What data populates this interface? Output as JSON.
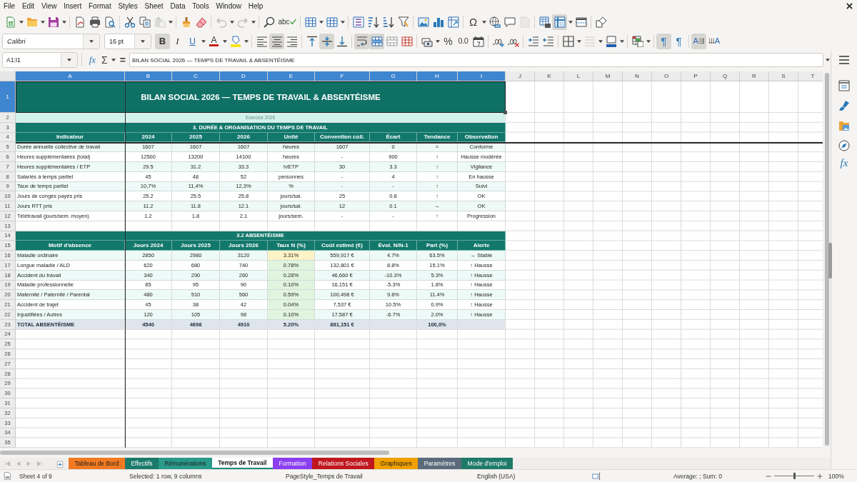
{
  "menu_bar": {
    "items": [
      "File",
      "Edit",
      "View",
      "Insert",
      "Format",
      "Styles",
      "Sheet",
      "Data",
      "Tools",
      "Window",
      "Help"
    ]
  },
  "standard_toolbar": {
    "paste_disabled": true,
    "undo_disabled": true,
    "redo_disabled": true,
    "spelling_label": "abc",
    "special_character_label": "Ω",
    "header_footer_disabled": true,
    "freeze_panes": true
  },
  "formatting_toolbar": {
    "font_name": "Calibri",
    "font_size": "16 pt",
    "bold_label": "B",
    "bold": true,
    "italic_label": "I",
    "italic": false,
    "underline_label": "U",
    "underline": false,
    "font_color_label": "A",
    "align_left": false,
    "align_center": true,
    "align_right": false,
    "align_top": false,
    "align_middle": true,
    "align_bottom": false,
    "wrap_text": true,
    "merge_and_center": true,
    "percent_label": "%",
    "number_label": "0.0",
    "border_style_disabled": true,
    "paragraph_ltr_label": "¶",
    "paragraph_ltr": true,
    "paragraph_rtl_label": "¶",
    "paragraph_rtl": false,
    "text_horizontal_label": "A",
    "text_horizontal": true,
    "text_vertical_label": "A",
    "text_vertical": false
  },
  "formula_bar": {
    "name_box": "A1:I1",
    "function_wizard_label": "fx",
    "sum_label": "Σ",
    "equals_label": "=",
    "content": "BILAN SOCIAL 2026 — TEMPS DE TRAVAIL & ABSENTÉISME"
  },
  "sidebar": {
    "functions_label": "fx"
  },
  "sheet": {
    "column_headers": [
      {
        "label": "A",
        "selected": true
      },
      {
        "label": "B",
        "selected": true
      },
      {
        "label": "C",
        "selected": true
      },
      {
        "label": "D",
        "selected": true
      },
      {
        "label": "E",
        "selected": true
      },
      {
        "label": "F",
        "selected": true
      },
      {
        "label": "G",
        "selected": true
      },
      {
        "label": "H",
        "selected": true
      },
      {
        "label": "I",
        "selected": true
      },
      {
        "label": "J",
        "selected": false
      },
      {
        "label": "K",
        "selected": false
      },
      {
        "label": "L",
        "selected": false
      },
      {
        "label": "M",
        "selected": false
      },
      {
        "label": "N",
        "selected": false
      },
      {
        "label": "O",
        "selected": false
      },
      {
        "label": "P",
        "selected": false
      },
      {
        "label": "Q",
        "selected": false
      },
      {
        "label": "R",
        "selected": false
      },
      {
        "label": "S",
        "selected": false
      },
      {
        "label": "T",
        "selected": false
      }
    ],
    "rows": [
      {
        "number": "1",
        "selected": true,
        "kind": "title",
        "text": "BILAN SOCIAL 2026 — TEMPS DE TRAVAIL & ABSENTÉISME"
      },
      {
        "number": "2",
        "selected": false,
        "kind": "subtitle",
        "text": "Exercice 2026"
      },
      {
        "number": "3",
        "selected": false,
        "kind": "section",
        "text": "3. DURÉE & ORGANISATION DU TEMPS DE TRAVAIL"
      },
      {
        "number": "4",
        "selected": false,
        "kind": "header",
        "cells": [
          "Indicateur",
          "2024",
          "2025",
          "2026",
          "Unité",
          "Convention coll.",
          "Écart",
          "Tendance",
          "Observation"
        ]
      },
      {
        "number": "5",
        "selected": false,
        "kind": "data",
        "cells": [
          "Durée annuelle collective de travail",
          "1607",
          "1607",
          "1607",
          "heures",
          "1607",
          "0",
          "=",
          "Conforme"
        ]
      },
      {
        "number": "6",
        "selected": false,
        "kind": "data",
        "cells": [
          "Heures supplémentaires (total)",
          "12500",
          "13200",
          "14100",
          "heures",
          "-",
          "900",
          "↑",
          "Hausse modérée"
        ]
      },
      {
        "number": "7",
        "selected": false,
        "kind": "data",
        "cells": [
          "Heures supplémentaires / ETP",
          "29.5",
          "31.2",
          "33.3",
          "h/ETP",
          "30",
          "3.3",
          "↑",
          "Vigilance"
        ]
      },
      {
        "number": "8",
        "selected": false,
        "kind": "data",
        "cells": [
          "Salariés à temps partiel",
          "45",
          "48",
          "52",
          "personnes",
          "-",
          "4",
          "↑",
          "En hausse"
        ]
      },
      {
        "number": "9",
        "selected": false,
        "kind": "data",
        "cells": [
          "Taux de temps partiel",
          "10,7%",
          "11,4%",
          "12,3%",
          "%",
          "-",
          "-",
          "↑",
          "Suivi"
        ]
      },
      {
        "number": "10",
        "selected": false,
        "kind": "data",
        "cells": [
          "Jours de congés payés pris",
          "25.2",
          "25.5",
          "25.8",
          "jours/sal.",
          "25",
          "0.8",
          "↑",
          "OK"
        ]
      },
      {
        "number": "11",
        "selected": false,
        "kind": "data",
        "cells": [
          "Jours RTT pris",
          "11.2",
          "11.8",
          "12.1",
          "jours/sal.",
          "12",
          "0.1",
          "→",
          "OK"
        ]
      },
      {
        "number": "12",
        "selected": false,
        "kind": "data",
        "cells": [
          "Télétravail (jours/sem. moyen)",
          "1.2",
          "1.8",
          "2.1",
          "jours/sem.",
          "-",
          "-",
          "↑",
          "Progression"
        ]
      },
      {
        "number": "13",
        "selected": false
      },
      {
        "number": "14",
        "selected": false,
        "kind": "section",
        "text": "3.2 ABSENTÉISME"
      },
      {
        "number": "15",
        "selected": false,
        "kind": "header",
        "cells": [
          "Motif d'absence",
          "Jours 2024",
          "Jours 2025",
          "Jours 2026",
          "Taux N (%)",
          "Coût estimé (€)",
          "Évol. N/N-1",
          "Part (%)",
          "Alerte"
        ]
      },
      {
        "number": "16",
        "selected": false,
        "kind": "data",
        "cells": [
          "Maladie ordinaire",
          "2850",
          "2980",
          "3120",
          {
            "text": "3.31%",
            "color": "#fdf3c6"
          },
          "559,917 €",
          "4.7%",
          "63.5%",
          "→ Stable"
        ]
      },
      {
        "number": "17",
        "selected": false,
        "kind": "data",
        "cells": [
          "Longue maladie / ALD",
          "620",
          "680",
          "740",
          {
            "text": "0.78%",
            "color": "#e0f4de"
          },
          "132,801 €",
          "8.8%",
          "15.1%",
          "↑ Hausse"
        ]
      },
      {
        "number": "18",
        "selected": false,
        "kind": "data",
        "cells": [
          "Accident du travail",
          "340",
          "290",
          "260",
          {
            "text": "0.28%",
            "color": "#e0f4de"
          },
          "46,660 €",
          "-10.3%",
          "5.3%",
          "↑ Hausse"
        ]
      },
      {
        "number": "19",
        "selected": false,
        "kind": "data",
        "cells": [
          "Maladie professionnelle",
          "85",
          "95",
          "90",
          {
            "text": "0.10%",
            "color": "#e0f4de"
          },
          "16,151 €",
          "-5.3%",
          "1.8%",
          "↑ Hausse"
        ]
      },
      {
        "number": "20",
        "selected": false,
        "kind": "data",
        "cells": [
          "Maternité / Paternité / Parental",
          "480",
          "510",
          "560",
          {
            "text": "0.59%",
            "color": "#e0f4de"
          },
          "100,498 €",
          "9.8%",
          "11.4%",
          "↑ Hausse"
        ]
      },
      {
        "number": "21",
        "selected": false,
        "kind": "data",
        "cells": [
          "Accident de trajet",
          "45",
          "38",
          "42",
          {
            "text": "0.04%",
            "color": "#e0f4de"
          },
          "7,537 €",
          "10.5%",
          "0.9%",
          "↑ Hausse"
        ]
      },
      {
        "number": "22",
        "selected": false,
        "kind": "data",
        "cells": [
          "Injustifiées / Autres",
          "120",
          "105",
          "98",
          {
            "text": "0.10%",
            "color": "#e0f4de"
          },
          "17,587 €",
          "-6.7%",
          "2.0%",
          "↑ Hausse"
        ]
      },
      {
        "number": "23",
        "selected": false,
        "kind": "total",
        "cells": [
          "TOTAL ABSENTÉISME",
          "4540",
          "4698",
          "4910",
          "5.20%",
          "881,151 €",
          null,
          "100,0%",
          null
        ]
      },
      {
        "number": "24",
        "selected": false
      },
      {
        "number": "25",
        "selected": false
      },
      {
        "number": "26",
        "selected": false
      },
      {
        "number": "27",
        "selected": false
      },
      {
        "number": "28",
        "selected": false
      },
      {
        "number": "29",
        "selected": false
      },
      {
        "number": "30",
        "selected": false
      },
      {
        "number": "31",
        "selected": false
      },
      {
        "number": "32",
        "selected": false
      },
      {
        "number": "33",
        "selected": false
      },
      {
        "number": "34",
        "selected": false
      },
      {
        "number": "35",
        "selected": false
      }
    ]
  },
  "sheet_tabs": [
    {
      "label": "Tableau de Bord",
      "selected": false,
      "color": "#f07a22"
    },
    {
      "label": "Effectifs",
      "selected": false,
      "color": "#1b7a6a"
    },
    {
      "label": "Rémunérations",
      "selected": false,
      "color": "#2a9a8a"
    },
    {
      "label": "Temps de Travail",
      "selected": true
    },
    {
      "label": "Formation",
      "selected": false,
      "color": "#8a3ff0"
    },
    {
      "label": "Relations Sociales",
      "selected": false,
      "color": "#c0171e"
    },
    {
      "label": "Graphiques",
      "selected": false,
      "color": "#f0a000"
    },
    {
      "label": "Paramètres",
      "selected": false,
      "color": "#5b6b7c"
    },
    {
      "label": "Mode d'emploi",
      "selected": false,
      "color": "#1f7a68"
    }
  ],
  "status_bar": {
    "sheet": "Sheet 4 of 9",
    "selection": "Selected: 1 row, 9 columns",
    "page_style": "PageStyle_Temps de Travail",
    "language": "English (USA)",
    "summary": "Average: ; Sum: 0",
    "zoom": "100%",
    "zoom_slider": {
      "level": 0.5
    }
  }
}
